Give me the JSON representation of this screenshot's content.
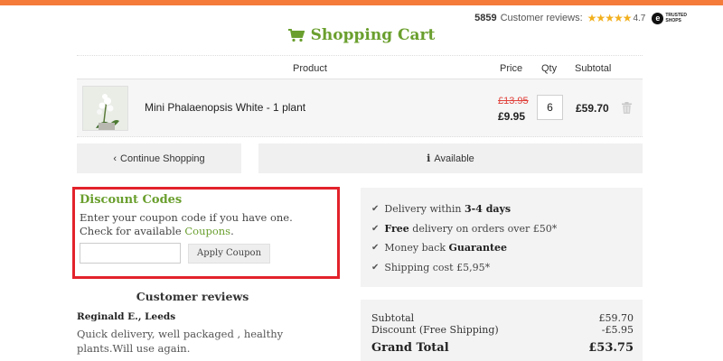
{
  "top_banner": {
    "text": "· · · · · · · · · · ·",
    "color": "#f47b3a"
  },
  "reviews_summary": {
    "count": "5859",
    "label": "Customer reviews:",
    "stars": "★★★★★",
    "score": "4.7",
    "badge_letter": "e",
    "badge_line1": "TRUSTED",
    "badge_line2": "SHOPS"
  },
  "page": {
    "title": "Shopping Cart",
    "title_icon": "shopping-cart-icon",
    "accent_color": "#6a9f2e"
  },
  "cart": {
    "columns": {
      "product": "Product",
      "price": "Price",
      "qty": "Qty",
      "subtotal": "Subtotal"
    },
    "items": [
      {
        "name": "Mini Phalaenopsis White - 1 plant",
        "old_price": "£13.95",
        "price": "£9.95",
        "qty": "6",
        "subtotal": "£59.70",
        "remove_icon": "trash-icon"
      }
    ]
  },
  "actions": {
    "continue_label": "Continue  Shopping",
    "continue_icon": "chevron-left-icon",
    "availability_label": "Available",
    "availability_icon": "info-icon"
  },
  "discount": {
    "title": "Discount Codes",
    "text": "Enter your coupon code if you have one. Check for available",
    "link": "Coupons",
    "link_suffix": ".",
    "input_value": "",
    "input_placeholder": "",
    "apply_label": "Apply Coupon",
    "highlight_color": "#e3222b"
  },
  "delivery_info": [
    {
      "pre": "Delivery within ",
      "bold": "3-4 days",
      "post": ""
    },
    {
      "pre": "",
      "bold": "Free",
      "post": " delivery on orders over £50*"
    },
    {
      "pre": "Money back ",
      "bold": "Guarantee",
      "post": ""
    },
    {
      "pre": "Shipping cost £5,95*",
      "bold": "",
      "post": ""
    }
  ],
  "totals": {
    "subtotal_label": "Subtotal",
    "subtotal_value": "£59.70",
    "discount_label": "Discount (Free Shipping)",
    "discount_value": "-£5.95",
    "grand_label": "Grand Total",
    "grand_value": "£53.75"
  },
  "customer_reviews": {
    "title": "Customer reviews",
    "reviews": [
      {
        "author": "Reginald E., Leeds",
        "text": "Quick delivery, well packaged , healthy plants.Will use again."
      }
    ]
  }
}
